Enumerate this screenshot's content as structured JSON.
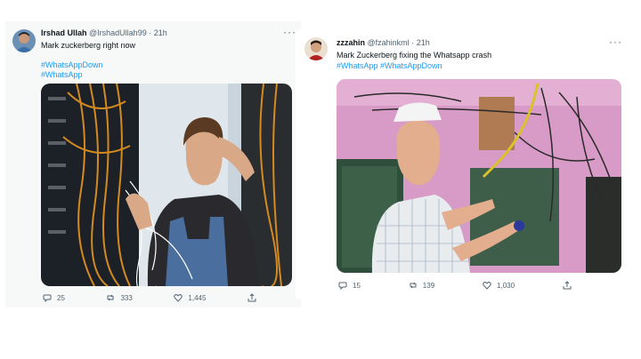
{
  "tweet1": {
    "name": "Irshad Ullah",
    "handle": "@IrshadUllah99",
    "sep": "·",
    "time": "21h",
    "text": "Mark zuckerberg right now",
    "hashtag1": "#WhatsAppDown",
    "hashtag2": "#WhatsApp",
    "replies": "25",
    "retweets": "333",
    "likes": "1,445"
  },
  "tweet2": {
    "name": "zzzahin",
    "handle": "@fzahinkml",
    "sep": "·",
    "time": "21h",
    "text": "Mark Zuckerberg fixing the Whatsapp crash",
    "hashtags": "#WhatsApp #WhatsAppDown",
    "replies": "15",
    "retweets": "139",
    "likes": "1,030"
  },
  "icons": [
    "more-icon",
    "reply-icon",
    "retweet-icon",
    "like-icon",
    "share-icon"
  ],
  "colors": {
    "link": "#1d9bf0",
    "text": "#0f1419",
    "muted": "#536471"
  }
}
